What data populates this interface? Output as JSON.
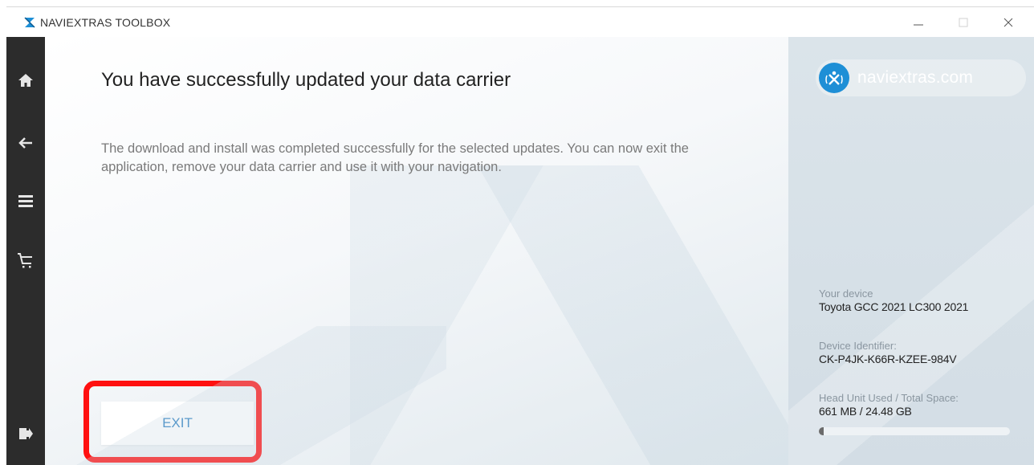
{
  "window": {
    "title": "NAVIEXTRAS TOOLBOX",
    "controls": [
      "minimize-icon",
      "maximize-icon",
      "close-icon"
    ]
  },
  "nav": {
    "items": [
      {
        "icon": "home-icon"
      },
      {
        "icon": "back-arrow-icon"
      },
      {
        "icon": "menu-icon"
      },
      {
        "icon": "cart-icon"
      },
      {
        "icon": "logout-icon"
      }
    ]
  },
  "main": {
    "heading": "You have successfully updated your data carrier",
    "body": "The download and install was completed successfully for the selected updates. You can now exit the application, remove your data carrier and use it with your navigation.",
    "exit_label": "EXIT"
  },
  "panel": {
    "brand": "naviextras.com",
    "device_label": "Your device",
    "device_value": "Toyota GCC 2021 LC300 2021",
    "id_label": "Device Identifier:",
    "id_value": "CK-P4JK-K66R-KZEE-984V",
    "space_label": "Head Unit Used / Total Space:",
    "space_value": "661 MB / 24.48 GB",
    "space_used_fraction": 0.027
  },
  "colors": {
    "accent": "#1e8fd6",
    "exit_text": "#2b7fc0",
    "highlight": "#ff1010",
    "rail": "#2c2c2c"
  }
}
